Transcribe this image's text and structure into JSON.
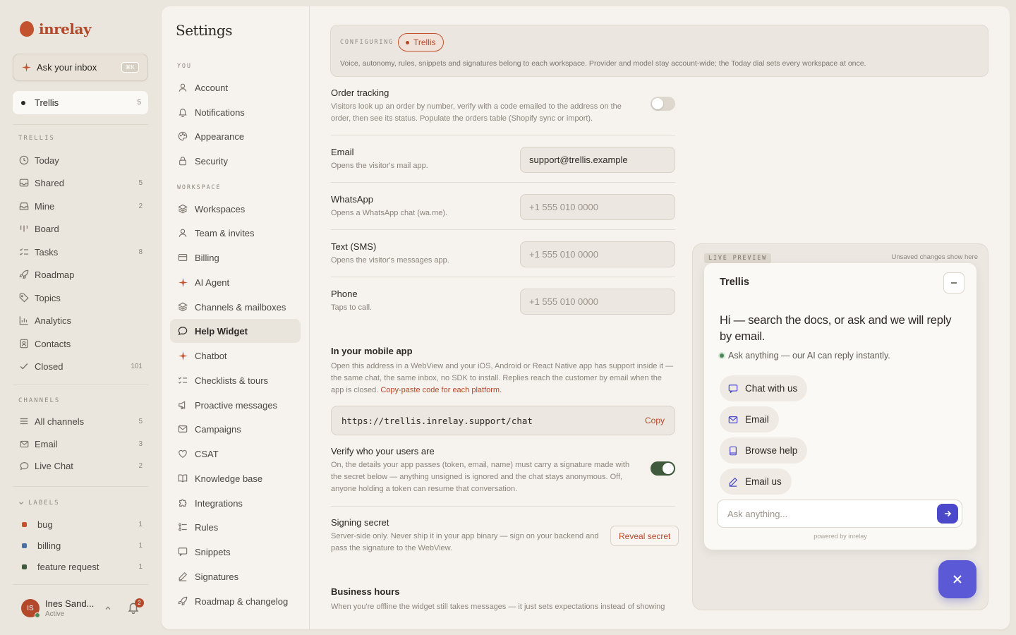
{
  "brand": {
    "name": "inrelay"
  },
  "sidebar": {
    "ask": {
      "label": "Ask your inbox",
      "shortcut": "⌘K"
    },
    "workspace": {
      "name": "Trellis",
      "count": "5"
    },
    "trellis_section": "TRELLIS",
    "items": [
      {
        "label": "Today",
        "count": "",
        "icon": "clock-icon"
      },
      {
        "label": "Shared",
        "count": "5",
        "icon": "inbox-icon"
      },
      {
        "label": "Mine",
        "count": "2",
        "icon": "tray-icon"
      },
      {
        "label": "Board",
        "count": "",
        "icon": "board-icon"
      },
      {
        "label": "Tasks",
        "count": "8",
        "icon": "tasks-icon"
      },
      {
        "label": "Roadmap",
        "count": "",
        "icon": "rocket-icon"
      },
      {
        "label": "Topics",
        "count": "",
        "icon": "tag-icon"
      },
      {
        "label": "Analytics",
        "count": "",
        "icon": "chart-icon"
      },
      {
        "label": "Contacts",
        "count": "",
        "icon": "contact-icon"
      },
      {
        "label": "Closed",
        "count": "101",
        "icon": "check-icon"
      }
    ],
    "channels_section": "CHANNELS",
    "channels": [
      {
        "label": "All channels",
        "count": "5",
        "icon": "lines-icon"
      },
      {
        "label": "Email",
        "count": "3",
        "icon": "mail-icon"
      },
      {
        "label": "Live Chat",
        "count": "2",
        "icon": "chat-icon"
      }
    ],
    "labels_section": "LABELS",
    "labels": [
      {
        "label": "bug",
        "count": "1",
        "color": "#c2532e"
      },
      {
        "label": "billing",
        "count": "1",
        "color": "#4a6fa5"
      },
      {
        "label": "feature request",
        "count": "1",
        "color": "#3f5a3c"
      }
    ],
    "user": {
      "initials": "IS",
      "name": "Ines Sand...",
      "status": "Active",
      "notifications": "2"
    }
  },
  "settings": {
    "title": "Settings",
    "you_section": "YOU",
    "you_items": [
      {
        "label": "Account",
        "icon": "user-icon"
      },
      {
        "label": "Notifications",
        "icon": "bell-icon"
      },
      {
        "label": "Appearance",
        "icon": "palette-icon"
      },
      {
        "label": "Security",
        "icon": "lock-icon"
      }
    ],
    "workspace_section": "WORKSPACE",
    "workspace_items": [
      {
        "label": "Workspaces",
        "icon": "layers-icon"
      },
      {
        "label": "Team & invites",
        "icon": "user-icon"
      },
      {
        "label": "Billing",
        "icon": "card-icon"
      },
      {
        "label": "AI Agent",
        "icon": "sparkle-icon"
      },
      {
        "label": "Channels & mailboxes",
        "icon": "layers-icon"
      },
      {
        "label": "Help Widget",
        "icon": "chat-icon"
      },
      {
        "label": "Chatbot",
        "icon": "sparkle-icon"
      },
      {
        "label": "Checklists & tours",
        "icon": "checklist-icon"
      },
      {
        "label": "Proactive messages",
        "icon": "megaphone-icon"
      },
      {
        "label": "Campaigns",
        "icon": "mail-icon"
      },
      {
        "label": "CSAT",
        "icon": "heart-icon"
      },
      {
        "label": "Knowledge base",
        "icon": "book-icon"
      },
      {
        "label": "Integrations",
        "icon": "puzzle-icon"
      },
      {
        "label": "Rules",
        "icon": "rules-icon"
      },
      {
        "label": "Snippets",
        "icon": "chat-icon"
      },
      {
        "label": "Signatures",
        "icon": "pen-icon"
      },
      {
        "label": "Roadmap & changelog",
        "icon": "rocket-icon"
      }
    ]
  },
  "config": {
    "label": "CONFIGURING",
    "workspace": "Trellis",
    "description": "Voice, autonomy, rules, snippets and signatures belong to each workspace. Provider and model stay account-wide; the Today dial sets every workspace at once."
  },
  "form": {
    "order_tracking": {
      "title": "Order tracking",
      "desc": "Visitors look up an order by number, verify with a code emailed to the address on the order, then see its status. Populate the orders table (Shopify sync or import).",
      "enabled": false
    },
    "email": {
      "title": "Email",
      "desc": "Opens the visitor's mail app.",
      "value": "support@trellis.example"
    },
    "whatsapp": {
      "title": "WhatsApp",
      "desc": "Opens a WhatsApp chat (wa.me).",
      "placeholder": "+1 555 010 0000"
    },
    "sms": {
      "title": "Text (SMS)",
      "desc": "Opens the visitor's messages app.",
      "placeholder": "+1 555 010 0000"
    },
    "phone": {
      "title": "Phone",
      "desc": "Taps to call.",
      "placeholder": "+1 555 010 0000"
    },
    "mobile": {
      "title": "In your mobile app",
      "desc": "Open this address in a WebView and your iOS, Android or React Native app has support inside it — the same chat, the same inbox, no SDK to install. Replies reach the customer by email when the app is closed.",
      "link": "Copy-paste code for each platform.",
      "url": "https://trellis.inrelay.support/chat",
      "copy": "Copy"
    },
    "verify": {
      "title": "Verify who your users are",
      "desc": "On, the details your app passes (token, email, name) must carry a signature made with the secret below — anything unsigned is ignored and the chat stays anonymous. Off, anyone holding a token can resume that conversation.",
      "enabled": true
    },
    "secret": {
      "title": "Signing secret",
      "desc": "Server-side only. Never ship it in your app binary — sign on your backend and pass the signature to the WebView.",
      "button": "Reveal secret"
    },
    "hours": {
      "title": "Business hours",
      "desc": "When you're offline the widget still takes messages — it just sets expectations instead of showing"
    }
  },
  "preview": {
    "label": "LIVE PREVIEW",
    "note": "Unsaved changes show here",
    "widget": {
      "title": "Trellis",
      "greeting": "Hi — search the docs, or ask and we will reply by email.",
      "subtitle": "Ask anything — our AI can reply instantly.",
      "buttons": [
        {
          "label": "Chat with us",
          "icon": "chat-icon"
        },
        {
          "label": "Email",
          "icon": "mail-icon"
        },
        {
          "label": "Browse help",
          "icon": "book-icon"
        },
        {
          "label": "Email us",
          "icon": "pen-icon"
        }
      ],
      "input_placeholder": "Ask anything...",
      "powered": "powered by inrelay"
    },
    "accent": "#4b49c9"
  }
}
